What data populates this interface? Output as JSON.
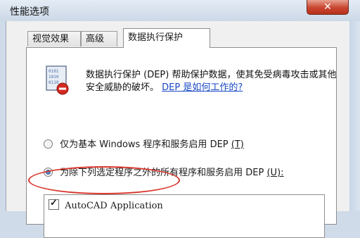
{
  "window": {
    "title": "性能选项",
    "close_label": "✕"
  },
  "tabs": [
    {
      "label": "视觉效果"
    },
    {
      "label": "高级"
    },
    {
      "label": "数据执行保护"
    }
  ],
  "dep_panel": {
    "description": "数据执行保护 (DEP) 帮助保护数据，使其免受病毒攻击或其他安全威胁的破坏。",
    "link": "DEP 是如何工作的?",
    "option_basic": "仅为基本 Windows 程序和服务启用 DEP",
    "option_basic_key": "(T)",
    "option_all": "为除下列选定程序之外的所有程序和服务启用 DEP",
    "option_all_key": "(U):",
    "selected_option": "option_all",
    "exceptions": [
      {
        "label": "AutoCAD Application",
        "checked": true
      }
    ]
  },
  "colors": {
    "highlight": "#d8342a",
    "link": "#1a49c4",
    "close": "#c8462f"
  },
  "icons": {
    "dep": "dep-shield-icon",
    "close": "close-icon"
  }
}
